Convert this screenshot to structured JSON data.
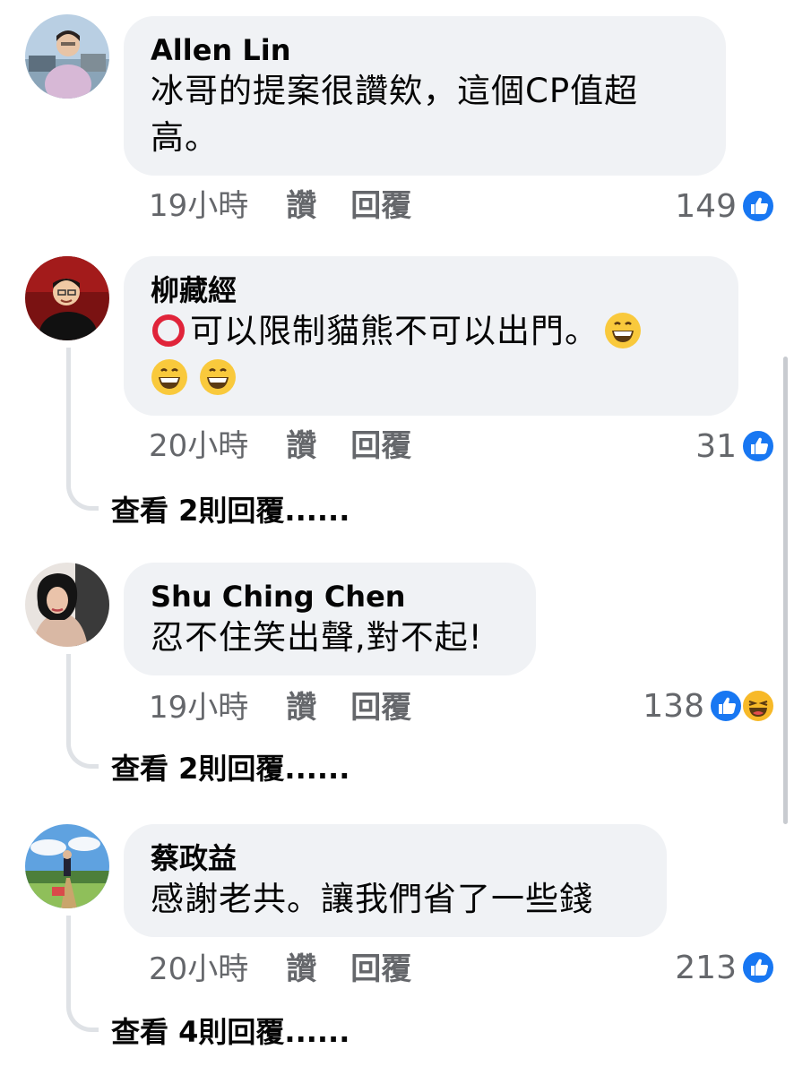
{
  "comments": [
    {
      "author": "Allen Lin",
      "text": "冰哥的提案很讚欸，這個CP值超高。",
      "time": "19小時",
      "like_label": "讚",
      "reply_label": "回覆",
      "reaction_count": "149",
      "reactions": [
        "like-icon"
      ]
    },
    {
      "author": "柳藏經",
      "text": "可以限制貓熊不可以出門。",
      "emoji_prefix": "heavy-large-circle-icon",
      "emoji_suffix": [
        "grinning-face-icon",
        "grinning-face-icon",
        "grinning-face-icon"
      ],
      "time": "20小時",
      "like_label": "讚",
      "reply_label": "回覆",
      "reaction_count": "31",
      "reactions": [
        "like-icon"
      ],
      "view_replies": "查看 2則回覆......"
    },
    {
      "author": "Shu Ching Chen",
      "text": "忍不住笑出聲,對不起!",
      "time": "19小時",
      "like_label": "讚",
      "reply_label": "回覆",
      "reaction_count": "138",
      "reactions": [
        "like-icon",
        "haha-icon"
      ],
      "view_replies": "查看 2則回覆......"
    },
    {
      "author": "蔡政益",
      "text": "感謝老共。讓我們省了一些錢",
      "time": "20小時",
      "like_label": "讚",
      "reply_label": "回覆",
      "reaction_count": "213",
      "reactions": [
        "like-icon"
      ],
      "view_replies": "查看 4則回覆......"
    }
  ],
  "colors": {
    "bubble": "#f0f2f5",
    "meta_text": "#65676b",
    "like_blue": "#1877f2",
    "haha_yellow": "#f7b928",
    "thread_line": "#dfe2e6"
  }
}
